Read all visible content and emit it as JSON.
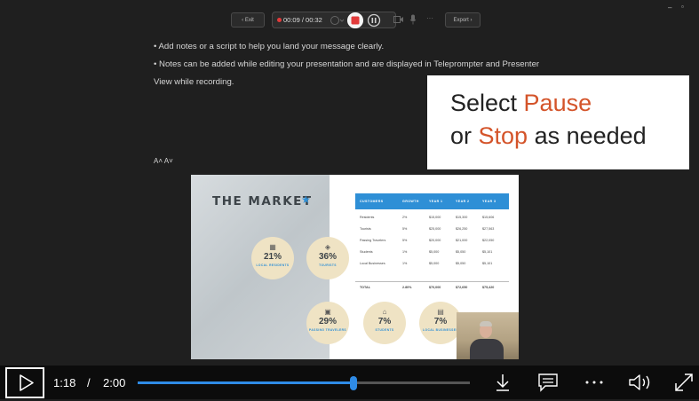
{
  "toolbar": {
    "exit_label": "‹  Exit",
    "timer": "00:09 / 00:32",
    "export_label": "Export  ›"
  },
  "window_controls": {
    "minimize": "–",
    "restore": "▫"
  },
  "notes": {
    "line1": "• Add notes or a script to help you land your message clearly.",
    "line2": "• Notes can be added while editing your presentation and are displayed in Teleprompter and Presenter",
    "line3": "View while recording.",
    "font_controls": "A˄  A˅"
  },
  "callout": {
    "line1_pre": "Select ",
    "line1_accent": "Pause",
    "line2_pre": "or ",
    "line2_accent": "Stop",
    "line2_post": " as needed",
    "accent_color": "#d4542a"
  },
  "slide": {
    "title": "THE MARKET",
    "bubbles": [
      {
        "icon": "building-icon",
        "pct": "21%",
        "label": "LOCAL RESIDENTS"
      },
      {
        "icon": "tourist-icon",
        "pct": "36%",
        "label": "TOURISTS"
      },
      {
        "icon": "traveler-icon",
        "pct": "29%",
        "label": "PASSING TRAVELERS"
      },
      {
        "icon": "student-icon",
        "pct": "7%",
        "label": "STUDENTS"
      },
      {
        "icon": "business-icon",
        "pct": "7%",
        "label": "LOCAL BUSINESSES"
      }
    ],
    "table": {
      "headers": [
        "CUSTOMERS",
        "GROWTH",
        "YEAR 1",
        "YEAR 2",
        "YEAR 3"
      ],
      "rows": [
        [
          "Residents",
          "2%",
          "$15,000",
          "$15,300",
          "$15,606"
        ],
        [
          "Tourists",
          "5%",
          "$25,000",
          "$26,250",
          "$27,563"
        ],
        [
          "Passing Travelers",
          "5%",
          "$20,000",
          "$21,000",
          "$22,050"
        ],
        [
          "Students",
          "1%",
          "$5,000",
          "$5,050",
          "$5,101"
        ],
        [
          "Local Businesses",
          "1%",
          "$5,000",
          "$5,050",
          "$5,101"
        ]
      ],
      "total": [
        "TOTAL",
        "2.80%",
        "$70,000",
        "$72,650",
        "$75,420"
      ]
    }
  },
  "player": {
    "current_time": "1:18",
    "separator": "/",
    "duration": "2:00",
    "progress_fraction": 0.65,
    "accent": "#2f8be6"
  }
}
